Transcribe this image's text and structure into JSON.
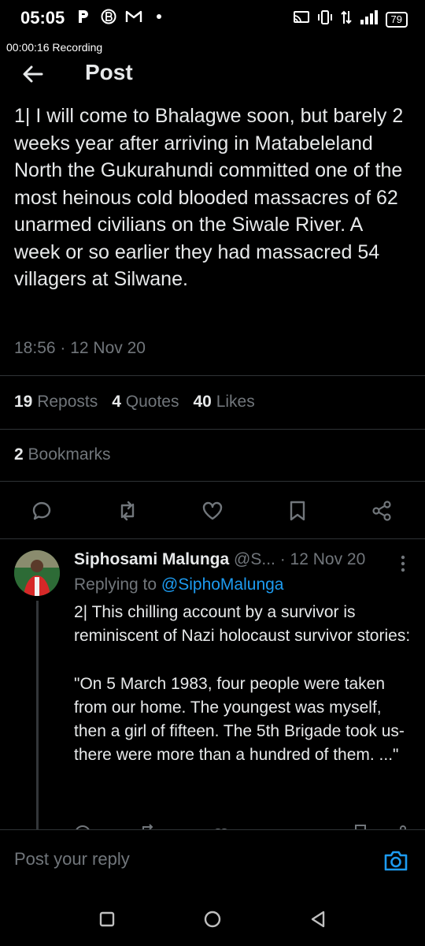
{
  "status_bar": {
    "time": "05:05",
    "battery": "79"
  },
  "recording": {
    "text": "00:00:16  Recording"
  },
  "header": {
    "title": "Post"
  },
  "post": {
    "text": "1| I will come to Bhalagwe soon, but barely 2 weeks year after arriving in Matabeleland North the Gukurahundi committed one of the most heinous cold blooded massacres of 62 unarmed civilians on the Siwale River. A week or so earlier they had massacred 54 villagers at Silwane.",
    "time": "18:56 · 12 Nov 20",
    "reposts_count": "19",
    "reposts_label": "Reposts",
    "quotes_count": "4",
    "quotes_label": "Quotes",
    "likes_count": "40",
    "likes_label": "Likes",
    "bookmarks_count": "2",
    "bookmarks_label": "Bookmarks"
  },
  "reply": {
    "name": "Siphosami Malunga",
    "handle": "@S...",
    "date": "· 12 Nov 20",
    "replying_prefix": "Replying to",
    "replying_handle": "@SiphoMalunga",
    "text": "2| This chilling account by a survivor is reminiscent of Nazi holocaust survivor stories:\n\n\"On 5 March 1983, four people were taken from our home. The youngest was myself, then a girl of fifteen. The 5th Brigade took us- there were more than a hundred of them. ...\""
  },
  "composer": {
    "placeholder": "Post your reply"
  },
  "colors": {
    "accent": "#1d9bf0",
    "muted": "#71767b",
    "text": "#e7e9ea",
    "background": "#000000"
  },
  "icons": [
    "back-arrow-icon",
    "reply-icon",
    "repost-icon",
    "like-icon",
    "bookmark-icon",
    "share-icon",
    "more-icon",
    "camera-icon"
  ]
}
